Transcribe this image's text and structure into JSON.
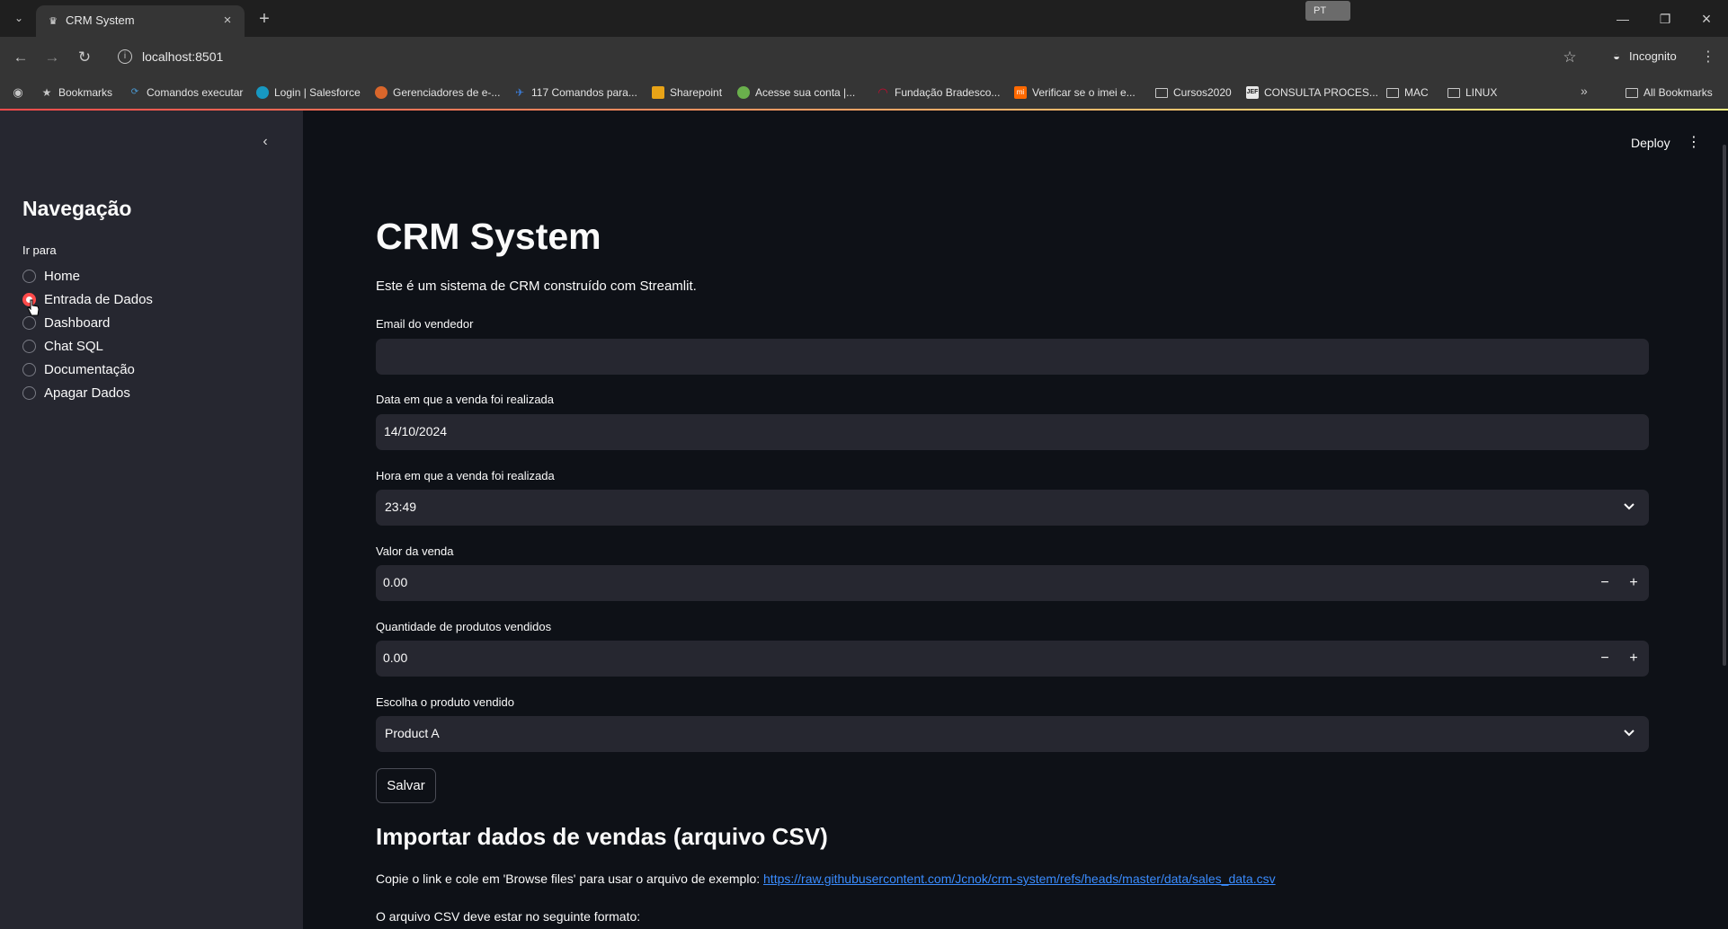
{
  "browser": {
    "tab_title": "CRM System",
    "new_tab_symbol": "+",
    "language_badge": "PT",
    "url": "localhost:8501",
    "profile_label": "Incognito",
    "all_bookmarks_label": "All Bookmarks",
    "bookmarks": [
      {
        "label": "Bookmarks",
        "icon": "star-icon",
        "color": "#c7c7c7"
      },
      {
        "label": "Comandos executar",
        "icon": "nodejs-icon",
        "color": "#4a9ad4"
      },
      {
        "label": "Login | Salesforce",
        "icon": "salesforce-cloud-icon",
        "color": "#1798c1"
      },
      {
        "label": "Gerenciadores de e-...",
        "icon": "site-icon",
        "color": "#d9662b"
      },
      {
        "label": "117 Comandos para...",
        "icon": "linux-icon",
        "color": "#3b7bd6"
      },
      {
        "label": "Sharepoint",
        "icon": "sharepoint-icon",
        "color": "#e8a317"
      },
      {
        "label": "Acesse sua conta |...",
        "icon": "site-icon",
        "color": "#6ab04c"
      },
      {
        "label": "Fundação Bradesco...",
        "icon": "bradesco-icon",
        "color": "#cc092f"
      },
      {
        "label": "Verificar se o imei e...",
        "icon": "xiaomi-icon",
        "color": "#ff6900"
      },
      {
        "label": "Cursos2020",
        "icon": "folder-icon",
        "color": "#c7c7c7"
      },
      {
        "label": "CONSULTA PROCES...",
        "icon": "jef-icon",
        "color": "#e8e8e8"
      },
      {
        "label": "MAC",
        "icon": "folder-icon",
        "color": "#c7c7c7"
      },
      {
        "label": "LINUX",
        "icon": "folder-icon",
        "color": "#c7c7c7"
      }
    ]
  },
  "sidebar": {
    "title": "Navegação",
    "radio_label": "Ir para",
    "items": [
      {
        "label": "Home",
        "selected": false
      },
      {
        "label": "Entrada de Dados",
        "selected": true
      },
      {
        "label": "Dashboard",
        "selected": false
      },
      {
        "label": "Chat SQL",
        "selected": false
      },
      {
        "label": "Documentação",
        "selected": false
      },
      {
        "label": "Apagar Dados",
        "selected": false
      }
    ]
  },
  "header": {
    "deploy_label": "Deploy"
  },
  "main": {
    "title": "CRM System",
    "intro": "Este é um sistema de CRM construído com Streamlit.",
    "fields": {
      "email": {
        "label": "Email do vendedor",
        "value": ""
      },
      "date": {
        "label": "Data em que a venda foi realizada",
        "value": "14/10/2024"
      },
      "time": {
        "label": "Hora em que a venda foi realizada",
        "value": "23:49"
      },
      "amount": {
        "label": "Valor da venda",
        "value": "0.00"
      },
      "quantity": {
        "label": "Quantidade de produtos vendidos",
        "value": "0.00"
      },
      "product": {
        "label": "Escolha o produto vendido",
        "value": "Product A"
      }
    },
    "stepper_minus": "−",
    "stepper_plus": "+",
    "save_label": "Salvar",
    "import_title": "Importar dados de vendas (arquivo CSV)",
    "copy_text": "Copie o link e cole em 'Browse files' para usar o arquivo de exemplo: ",
    "copy_link": "https://raw.githubusercontent.com/Jcnok/crm-system/refs/heads/master/data/sales_data.csv",
    "format_text": "O arquivo CSV deve estar no seguinte formato:"
  },
  "colors": {
    "accent": "#ff4b4b",
    "link": "#3a8cff",
    "background": "#0e1117",
    "sidebar": "#262730"
  }
}
